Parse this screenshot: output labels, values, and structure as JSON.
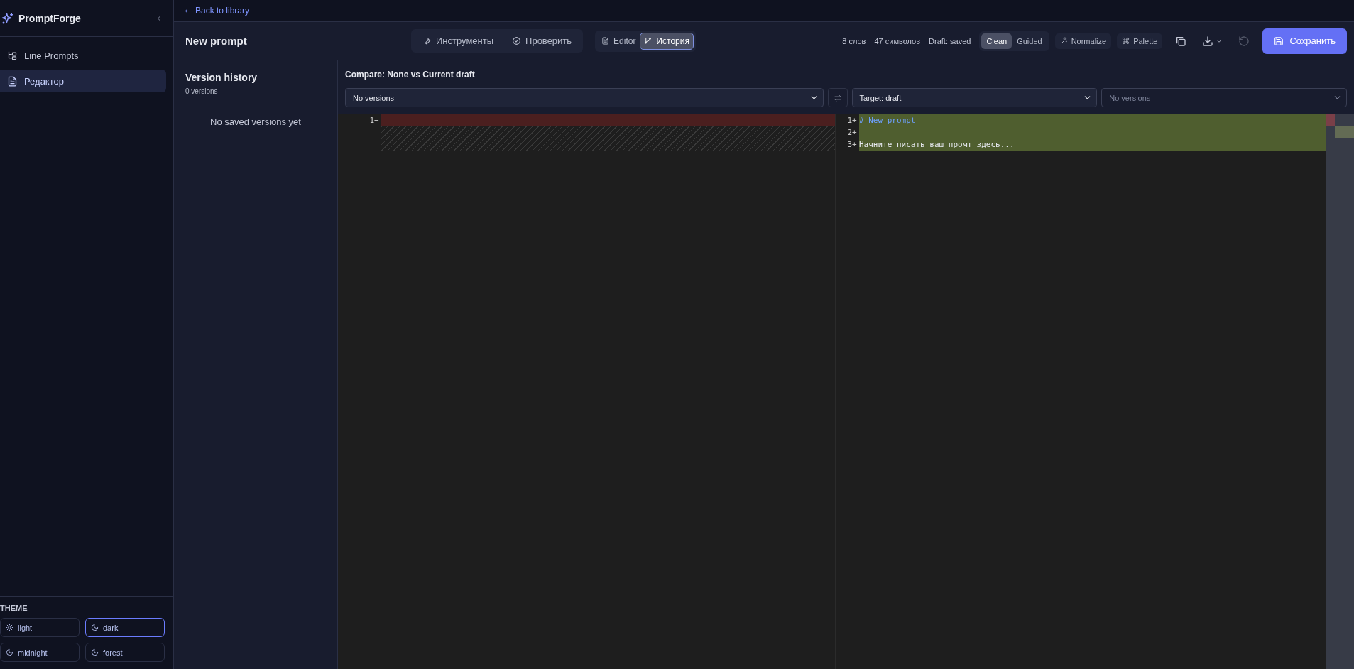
{
  "sidebar": {
    "brand": "PromptForge",
    "nav": [
      {
        "label": "Line Prompts",
        "selected": false
      },
      {
        "label": "Редактор",
        "selected": true
      }
    ],
    "theme": {
      "heading": "THEME",
      "options": [
        {
          "label": "light",
          "selected": false
        },
        {
          "label": "dark",
          "selected": true
        },
        {
          "label": "midnight",
          "selected": false
        },
        {
          "label": "forest",
          "selected": false
        }
      ]
    }
  },
  "back_link": "Back to library",
  "header": {
    "title": "New prompt",
    "tools": [
      "Инструменты",
      "Проверить"
    ],
    "views": [
      {
        "label": "Editor",
        "selected": false
      },
      {
        "label": "История",
        "selected": true
      }
    ],
    "stats": [
      "8 слов",
      "47 символов",
      "Draft: saved"
    ],
    "modes": [
      {
        "label": "Clean",
        "selected": true
      },
      {
        "label": "Guided",
        "selected": false
      }
    ],
    "actions": [
      "Normalize",
      "Palette"
    ],
    "icon_buttons": [
      {
        "disabled": false
      },
      {
        "disabled": false
      },
      {
        "disabled": true
      }
    ],
    "save": "Сохранить"
  },
  "version_history": {
    "title": "Version history",
    "count": "0 versions",
    "empty": "No saved versions yet"
  },
  "compare": {
    "title": "Compare: None vs Current draft",
    "selects": [
      {
        "value": "No versions",
        "disabled": false
      },
      {
        "value": "Target: draft",
        "disabled": false
      },
      {
        "value": "No versions",
        "disabled": true
      }
    ]
  },
  "diff": {
    "left": [
      {
        "number": "1",
        "marker": "−",
        "kind": "removed"
      }
    ],
    "right": [
      {
        "number": "1",
        "marker": "+",
        "text": "# New prompt",
        "kind": "added",
        "heading": true
      },
      {
        "number": "2",
        "marker": "+",
        "kind": "added"
      },
      {
        "number": "3",
        "marker": "+",
        "text": "Начните писать ваш промт здесь...",
        "kind": "added",
        "heading": false
      }
    ]
  }
}
